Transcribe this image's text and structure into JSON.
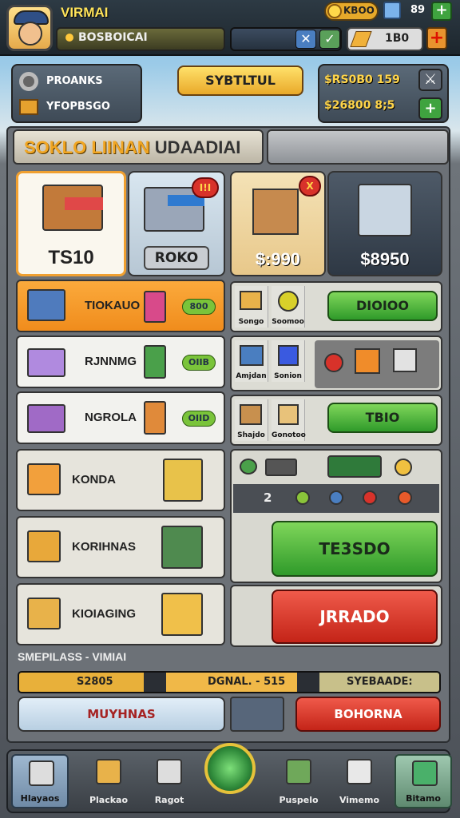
{
  "header": {
    "player_name": "VIRMAI",
    "subtitle": "BOSBOICAI",
    "gold": "KBOO",
    "gems": "89",
    "energy": "1B0"
  },
  "resources": {
    "row1": "PROANKS",
    "row2": "YFOPBSGO"
  },
  "status_button": "SYBTLTUL",
  "money": {
    "row1": "$RS0B0  159",
    "row2": "$26800  8;5"
  },
  "panel_title": {
    "highlight": "SOKLO LIINAN",
    "rest": "UDAADIAI"
  },
  "top_cards": [
    {
      "label": "TS10"
    },
    {
      "label": "ROKO",
      "badge": "I!I"
    },
    {
      "label": "$:990",
      "badge": "X"
    },
    {
      "label": "$8950"
    }
  ],
  "shop_rows": [
    {
      "label": "TIOKAUO",
      "price": "800"
    },
    {
      "label": "RJNNMG",
      "price": "OIIB"
    },
    {
      "label": "NGROLA",
      "price": "OIID"
    },
    {
      "label": "KONDA"
    },
    {
      "label": "KORIHNAS"
    },
    {
      "label": "KIOIAGING"
    }
  ],
  "right_rows": {
    "row1": {
      "mini1": "Songo",
      "mini2": "Soomoo",
      "button": "DIOIOO"
    },
    "row2": {
      "mini1": "Amjdan",
      "mini2": "Sonion"
    },
    "row3": {
      "mini1": "Shajdo",
      "mini2": "Gonotoo",
      "button": "TBIO"
    },
    "counter": "2"
  },
  "big_green_button": "TE3SDO",
  "big_red_button": "JRRADO",
  "bottom": {
    "section_label": "SMEPILASS - VIMIAI",
    "progress_left": "S2805",
    "progress_mid": "DGNAL. - 515",
    "progress_right": "SYEBAADE:",
    "input_text": "MUYHNAS",
    "red_button": "BOHORNA"
  },
  "nav": [
    {
      "label": "Hlayaos"
    },
    {
      "label": "Plackao"
    },
    {
      "label": "Ragot"
    },
    {
      "label": "Puspelo"
    },
    {
      "label": "Vimemo"
    },
    {
      "label": "Bitamo"
    }
  ],
  "colors": {
    "accent_orange": "#f59a2a",
    "green": "#3fa33f",
    "red": "#d8322a",
    "gold": "#ffd54a"
  }
}
